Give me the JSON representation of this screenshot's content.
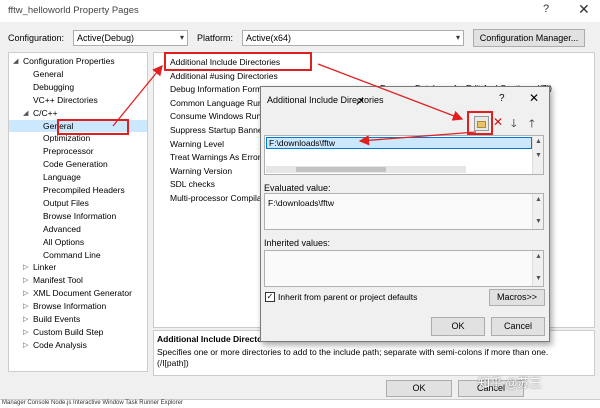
{
  "window": {
    "title": "fftw_helloworld Property Pages",
    "help_glyph": "?",
    "close_glyph": "✕"
  },
  "config_bar": {
    "configuration_label": "Configuration:",
    "configuration_value": "Active(Debug)",
    "platform_label": "Platform:",
    "platform_value": "Active(x64)",
    "manager_button": "Configuration Manager..."
  },
  "tree": {
    "items": [
      {
        "label": "Configuration Properties",
        "expanded": true
      },
      {
        "label": "General"
      },
      {
        "label": "Debugging"
      },
      {
        "label": "VC++ Directories"
      },
      {
        "label": "C/C++",
        "expanded": true
      },
      {
        "label": "General",
        "selected": true
      },
      {
        "label": "Optimization"
      },
      {
        "label": "Preprocessor"
      },
      {
        "label": "Code Generation"
      },
      {
        "label": "Language"
      },
      {
        "label": "Precompiled Headers"
      },
      {
        "label": "Output Files"
      },
      {
        "label": "Browse Information"
      },
      {
        "label": "Advanced"
      },
      {
        "label": "All Options"
      },
      {
        "label": "Command Line"
      },
      {
        "label": "Linker"
      },
      {
        "label": "Manifest Tool"
      },
      {
        "label": "XML Document Generator"
      },
      {
        "label": "Browse Information"
      },
      {
        "label": "Build Events"
      },
      {
        "label": "Custom Build Step"
      },
      {
        "label": "Code Analysis"
      }
    ]
  },
  "properties": {
    "rows": [
      "Additional Include Directories",
      "Additional #using Directories",
      "Debug Information Format",
      "Common Language Runtime",
      "Consume Windows Runtime",
      "Suppress Startup Banner",
      "Warning Level",
      "Treat Warnings As Error",
      "Warning Version",
      "SDL checks",
      "Multi-processor Compila"
    ],
    "partial_right_text": "Program Database for Edit And Continue (/ZI)",
    "description_title": "Additional Include Directo",
    "description_text": "Specifies one or more directories to add to the include path; separate with semi-colons if more than one.",
    "description_text2": "(/I[path])"
  },
  "dialog": {
    "title": "Additional Include Directories",
    "help_glyph": "?",
    "close_glyph": "✕",
    "list_value": "F:\\downloads\\fftw",
    "evaluated_label": "Evaluated value:",
    "evaluated_value": "F:\\downloads\\fftw",
    "inherited_label": "Inherited values:",
    "inherit_checkbox_label": "Inherit from parent or project defaults",
    "macros_button": "Macros>>",
    "ok_button": "OK",
    "cancel_button": "Cancel"
  },
  "footer": {
    "ok_button": "OK",
    "cancel_button": "Cancel",
    "bottom_text": "Manager Console   Node.js Interactive Window   Task Runner Explorer",
    "watermark": "知乎 @苏三"
  },
  "colors": {
    "annotation_red": "#e02020",
    "selection_blue": "#0078d7",
    "list_highlight": "#cce8ff"
  }
}
